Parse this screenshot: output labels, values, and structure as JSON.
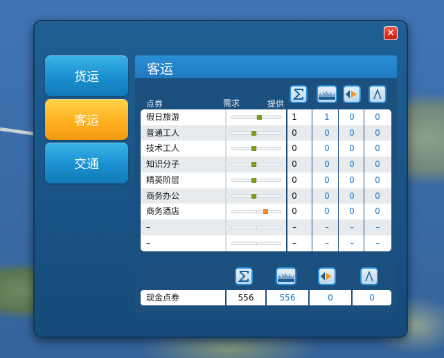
{
  "window": {
    "close_label": "✕"
  },
  "nav": [
    {
      "label": "货运",
      "active": false
    },
    {
      "label": "客运",
      "active": true
    },
    {
      "label": "交通",
      "active": false
    }
  ],
  "section": {
    "title": "客运"
  },
  "table": {
    "headers": {
      "name": "点券",
      "demand": "需求",
      "supply": "提供"
    },
    "stat_icons": [
      "sigma-icon",
      "histogram-icon",
      "flag-arrow-icon",
      "lambda-icon"
    ],
    "rows": [
      {
        "name": "假日旅游",
        "demand_level": 0.55,
        "marker_color": "#7a9a1e",
        "supply": "1",
        "v1": "1",
        "v2": "0",
        "v3": "0"
      },
      {
        "name": "普通工人",
        "demand_level": 0.45,
        "marker_color": "#7a9a1e",
        "supply": "0",
        "v1": "0",
        "v2": "0",
        "v3": "0"
      },
      {
        "name": "技术工人",
        "demand_level": 0.45,
        "marker_color": "#7a9a1e",
        "supply": "0",
        "v1": "0",
        "v2": "0",
        "v3": "0"
      },
      {
        "name": "知识分子",
        "demand_level": 0.45,
        "marker_color": "#7a9a1e",
        "supply": "0",
        "v1": "0",
        "v2": "0",
        "v3": "0"
      },
      {
        "name": "精英阶层",
        "demand_level": 0.45,
        "marker_color": "#7a9a1e",
        "supply": "0",
        "v1": "0",
        "v2": "0",
        "v3": "0"
      },
      {
        "name": "商务办公",
        "demand_level": 0.45,
        "marker_color": "#7a9a1e",
        "supply": "0",
        "v1": "0",
        "v2": "0",
        "v3": "0"
      },
      {
        "name": "商务酒店",
        "demand_level": 0.68,
        "marker_color": "#f08a24",
        "supply": "0",
        "v1": "0",
        "v2": "0",
        "v3": "0"
      },
      {
        "name": "–",
        "demand_level": null,
        "marker_color": "",
        "supply": "–",
        "v1": "–",
        "v2": "–",
        "v3": "–"
      },
      {
        "name": "–",
        "demand_level": null,
        "marker_color": "",
        "supply": "–",
        "v1": "–",
        "v2": "–",
        "v3": "–"
      }
    ]
  },
  "summary": {
    "label": "现金点券",
    "total": "556",
    "v1": "556",
    "v2": "0",
    "v3": "0"
  },
  "colors": {
    "accent_blue": "#2a8fd6",
    "active_tab": "#ffb020",
    "value_blue": "#1a78c8"
  }
}
